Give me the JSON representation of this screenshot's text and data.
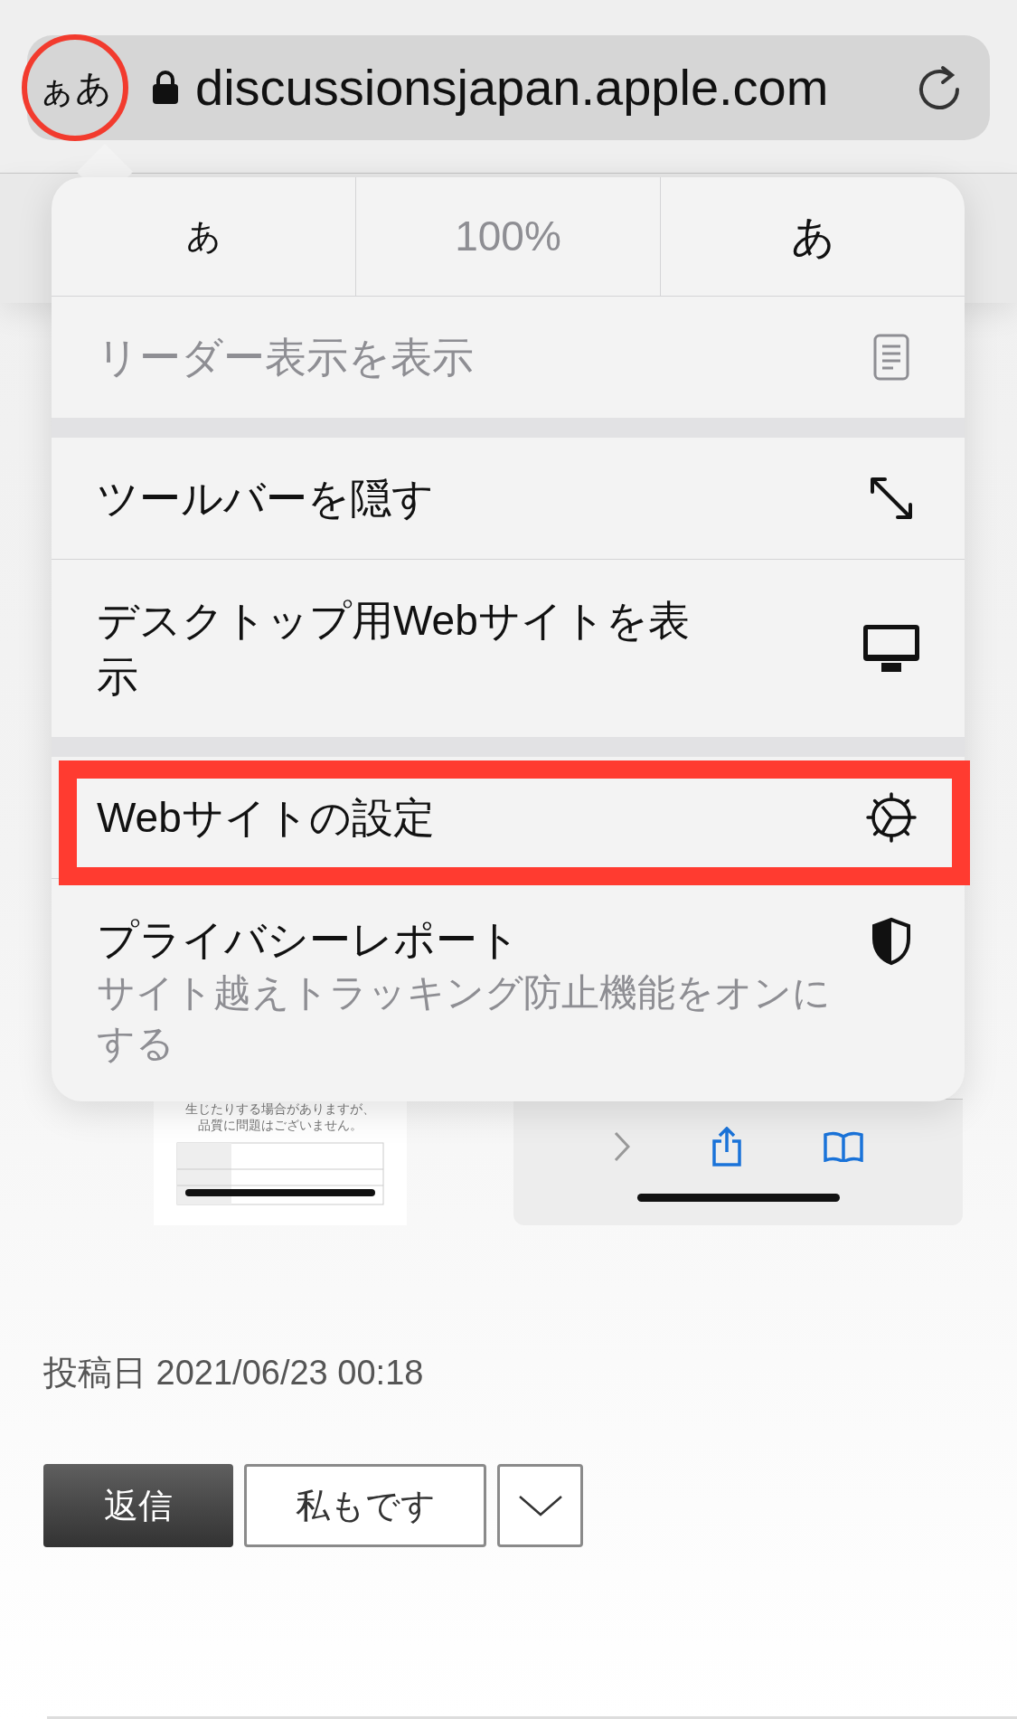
{
  "address_bar": {
    "text_size_button": "ぁあ",
    "highlighted": true,
    "url": "discussionsjapan.apple.com"
  },
  "menu": {
    "font_size_row": [
      {
        "kind": "smaller",
        "label": "あ"
      },
      {
        "kind": "zoom",
        "label": "100%"
      },
      {
        "kind": "larger",
        "label": "あ"
      }
    ],
    "sections": [
      {
        "items": [
          {
            "label": "リーダー表示を表示",
            "kind": "reader",
            "disabled": true,
            "highlighted": false
          }
        ]
      },
      {
        "items": [
          {
            "label": "ツールバーを隠す",
            "kind": "expand",
            "disabled": false,
            "highlighted": false
          },
          {
            "label": "デスクトップ用Webサイトを表示",
            "kind": "desktop",
            "disabled": false,
            "highlighted": false
          }
        ]
      },
      {
        "items": [
          {
            "label": "Webサイトの設定",
            "kind": "gear",
            "disabled": false,
            "highlighted": true
          },
          {
            "label": "プライバシーレポート",
            "subtitle": "サイト越えトラッキング防止機能をオンにする",
            "kind": "shield",
            "disabled": false,
            "highlighted": false
          }
        ]
      }
    ]
  },
  "post": {
    "image_text": [
      "生じたりする場合がありますが、",
      "品質に問題はございません。"
    ],
    "date": "投稿日 2021/06/23 00:18",
    "buttons": [
      {
        "label": "返信",
        "kind": "primary"
      },
      {
        "label": "私もです",
        "kind": "secondary"
      },
      {
        "kind": "dropdown"
      }
    ]
  }
}
